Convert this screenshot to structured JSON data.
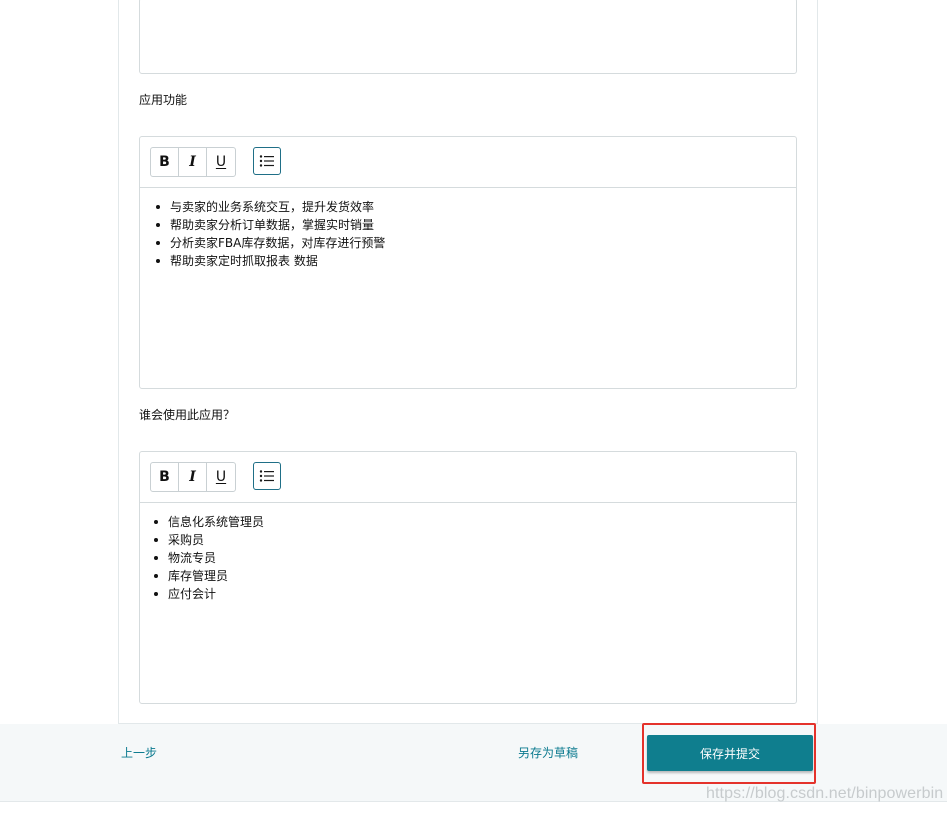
{
  "sections": [
    {
      "label": "应用功能",
      "toolbar": {
        "bold": "B",
        "italic": "I",
        "underline": "U",
        "list_icon": "bulleted-list-icon"
      },
      "items": [
        "与卖家的业务系统交互，提升发货效率",
        "帮助卖家分析订单数据，掌握实时销量",
        "分析卖家FBA库存数据，对库存进行预警",
        "帮助卖家定时抓取报表 数据"
      ]
    },
    {
      "label": "谁会使用此应用？",
      "toolbar": {
        "bold": "B",
        "italic": "I",
        "underline": "U",
        "list_icon": "bulleted-list-icon"
      },
      "items": [
        "信息化系统管理员",
        "采购员",
        "物流专员",
        "库存管理员",
        "应付会计"
      ]
    }
  ],
  "footer": {
    "prev_label": "上一步",
    "draft_label": "另存为草稿",
    "submit_label": "保存并提交"
  },
  "watermark": "https://blog.csdn.net/binpowerbin",
  "colors": {
    "accent": "#0f7e8e",
    "link": "#0b7a8f",
    "highlight": "#e4322b",
    "border": "#d5dbdd"
  }
}
